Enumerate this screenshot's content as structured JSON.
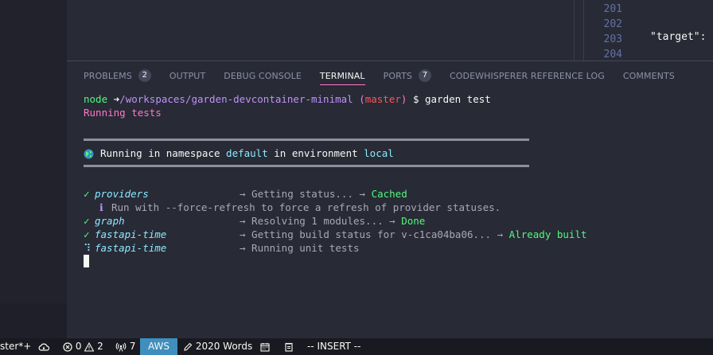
{
  "editor": {
    "line_numbers": [
      "201",
      "202",
      "203",
      "204"
    ],
    "code_line_203": "\"target\": '"
  },
  "panel": {
    "tabs": [
      {
        "label": "PROBLEMS",
        "badge": "2"
      },
      {
        "label": "OUTPUT"
      },
      {
        "label": "DEBUG CONSOLE"
      },
      {
        "label": "TERMINAL",
        "active": true
      },
      {
        "label": "PORTS",
        "badge": "7"
      },
      {
        "label": "CODEWHISPERER REFERENCE LOG"
      },
      {
        "label": "COMMENTS"
      }
    ]
  },
  "terminal": {
    "prompt_user": "node",
    "prompt_arrow": "➜",
    "prompt_path": "/workspaces/garden-devcontainer-minimal",
    "prompt_branch_open": "(",
    "prompt_branch": "master",
    "prompt_branch_close": ")",
    "prompt_command": "$ garden test",
    "running_tests": "Running tests",
    "namespace_prefix": "Running in namespace",
    "namespace_value": "default",
    "environment_prefix": "in environment",
    "environment_value": "local",
    "tasks": [
      {
        "status": "✓",
        "name": "providers",
        "message": "→ Getting status... →",
        "result": "Cached"
      },
      {
        "info_icon": "ℹ",
        "info": "Run with --force-refresh to force a refresh of provider statuses."
      },
      {
        "status": "✓",
        "name": "graph",
        "message": "→ Resolving 1 modules... →",
        "result": "Done"
      },
      {
        "status": "✓",
        "name": "fastapi-time",
        "message": "→ Getting build status for v-c1ca04ba06... →",
        "result": "Already built"
      },
      {
        "status": "⠹",
        "name": "fastapi-time",
        "message": "→ Running unit tests",
        "result": ""
      }
    ]
  },
  "statusbar": {
    "branch": "ster*+",
    "errors": "0",
    "warnings": "2",
    "ports": "7",
    "aws": "AWS",
    "words": "2020 Words",
    "mode": "-- INSERT --"
  },
  "colors": {
    "background": "#282a36",
    "accent_pink": "#ff79c6",
    "success_green": "#50fa7b",
    "aws_blue": "#3e8fbd"
  }
}
